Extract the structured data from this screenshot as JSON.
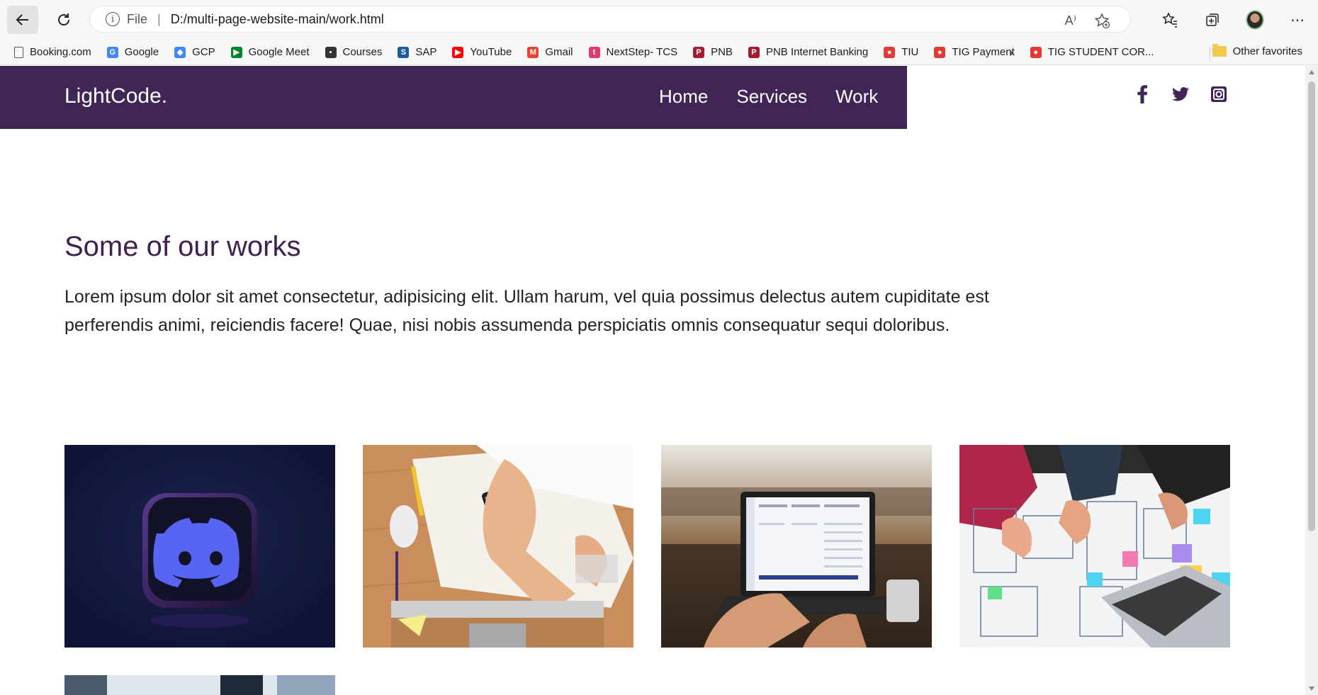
{
  "browser": {
    "address": {
      "scheme": "File",
      "separator": "|",
      "url": "D:/multi-page-website-main/work.html"
    },
    "read_aloud_label": "A⁾"
  },
  "bookmarks": [
    {
      "label": "Booking.com",
      "icon": "page-icon",
      "color": "#555555"
    },
    {
      "label": "Google",
      "icon": "google-icon",
      "color": "#4285f4"
    },
    {
      "label": "GCP",
      "icon": "gcp-icon",
      "color": "#4285f4"
    },
    {
      "label": "Google Meet",
      "icon": "meet-icon",
      "color": "#00832d"
    },
    {
      "label": "Courses",
      "icon": "courses-icon",
      "color": "#333333"
    },
    {
      "label": "SAP",
      "icon": "sap-icon",
      "color": "#1a5aa0"
    },
    {
      "label": "YouTube",
      "icon": "youtube-icon",
      "color": "#ff0000"
    },
    {
      "label": "Gmail",
      "icon": "gmail-icon",
      "color": "#ea4335"
    },
    {
      "label": "NextStep- TCS",
      "icon": "tcs-icon",
      "color": "#e23a6a"
    },
    {
      "label": "PNB",
      "icon": "pnb-icon",
      "color": "#a51c30"
    },
    {
      "label": "PNB Internet Banking",
      "icon": "pnb-icon",
      "color": "#a51c30"
    },
    {
      "label": "TIU",
      "icon": "tiu-icon",
      "color": "#e53935"
    },
    {
      "label": "TIG Payment",
      "icon": "tiu-icon",
      "color": "#e53935"
    },
    {
      "label": "TIG STUDENT COR...",
      "icon": "tiu-icon",
      "color": "#e53935"
    }
  ],
  "bookmarks_other": "Other favorites",
  "site": {
    "logo": "LightCode.",
    "nav": [
      "Home",
      "Services",
      "Work"
    ],
    "brand_color": "#402656",
    "social": [
      "facebook-icon",
      "twitter-icon",
      "instagram-icon"
    ]
  },
  "works": {
    "title": "Some of our works",
    "description": "Lorem ipsum dolor sit amet consectetur, adipisicing elit. Ullam harum, vel quia possimus delectus autem cupiditate est perferendis animi, reiciendis facere! Quae, nisi nobis assumenda perspiciatis omnis consequatur sequi doloribus.",
    "images": [
      "discord-logo-image",
      "desk-sketch-image",
      "laptop-dashboard-image",
      "wireframe-planning-image",
      "workspace-image"
    ]
  }
}
